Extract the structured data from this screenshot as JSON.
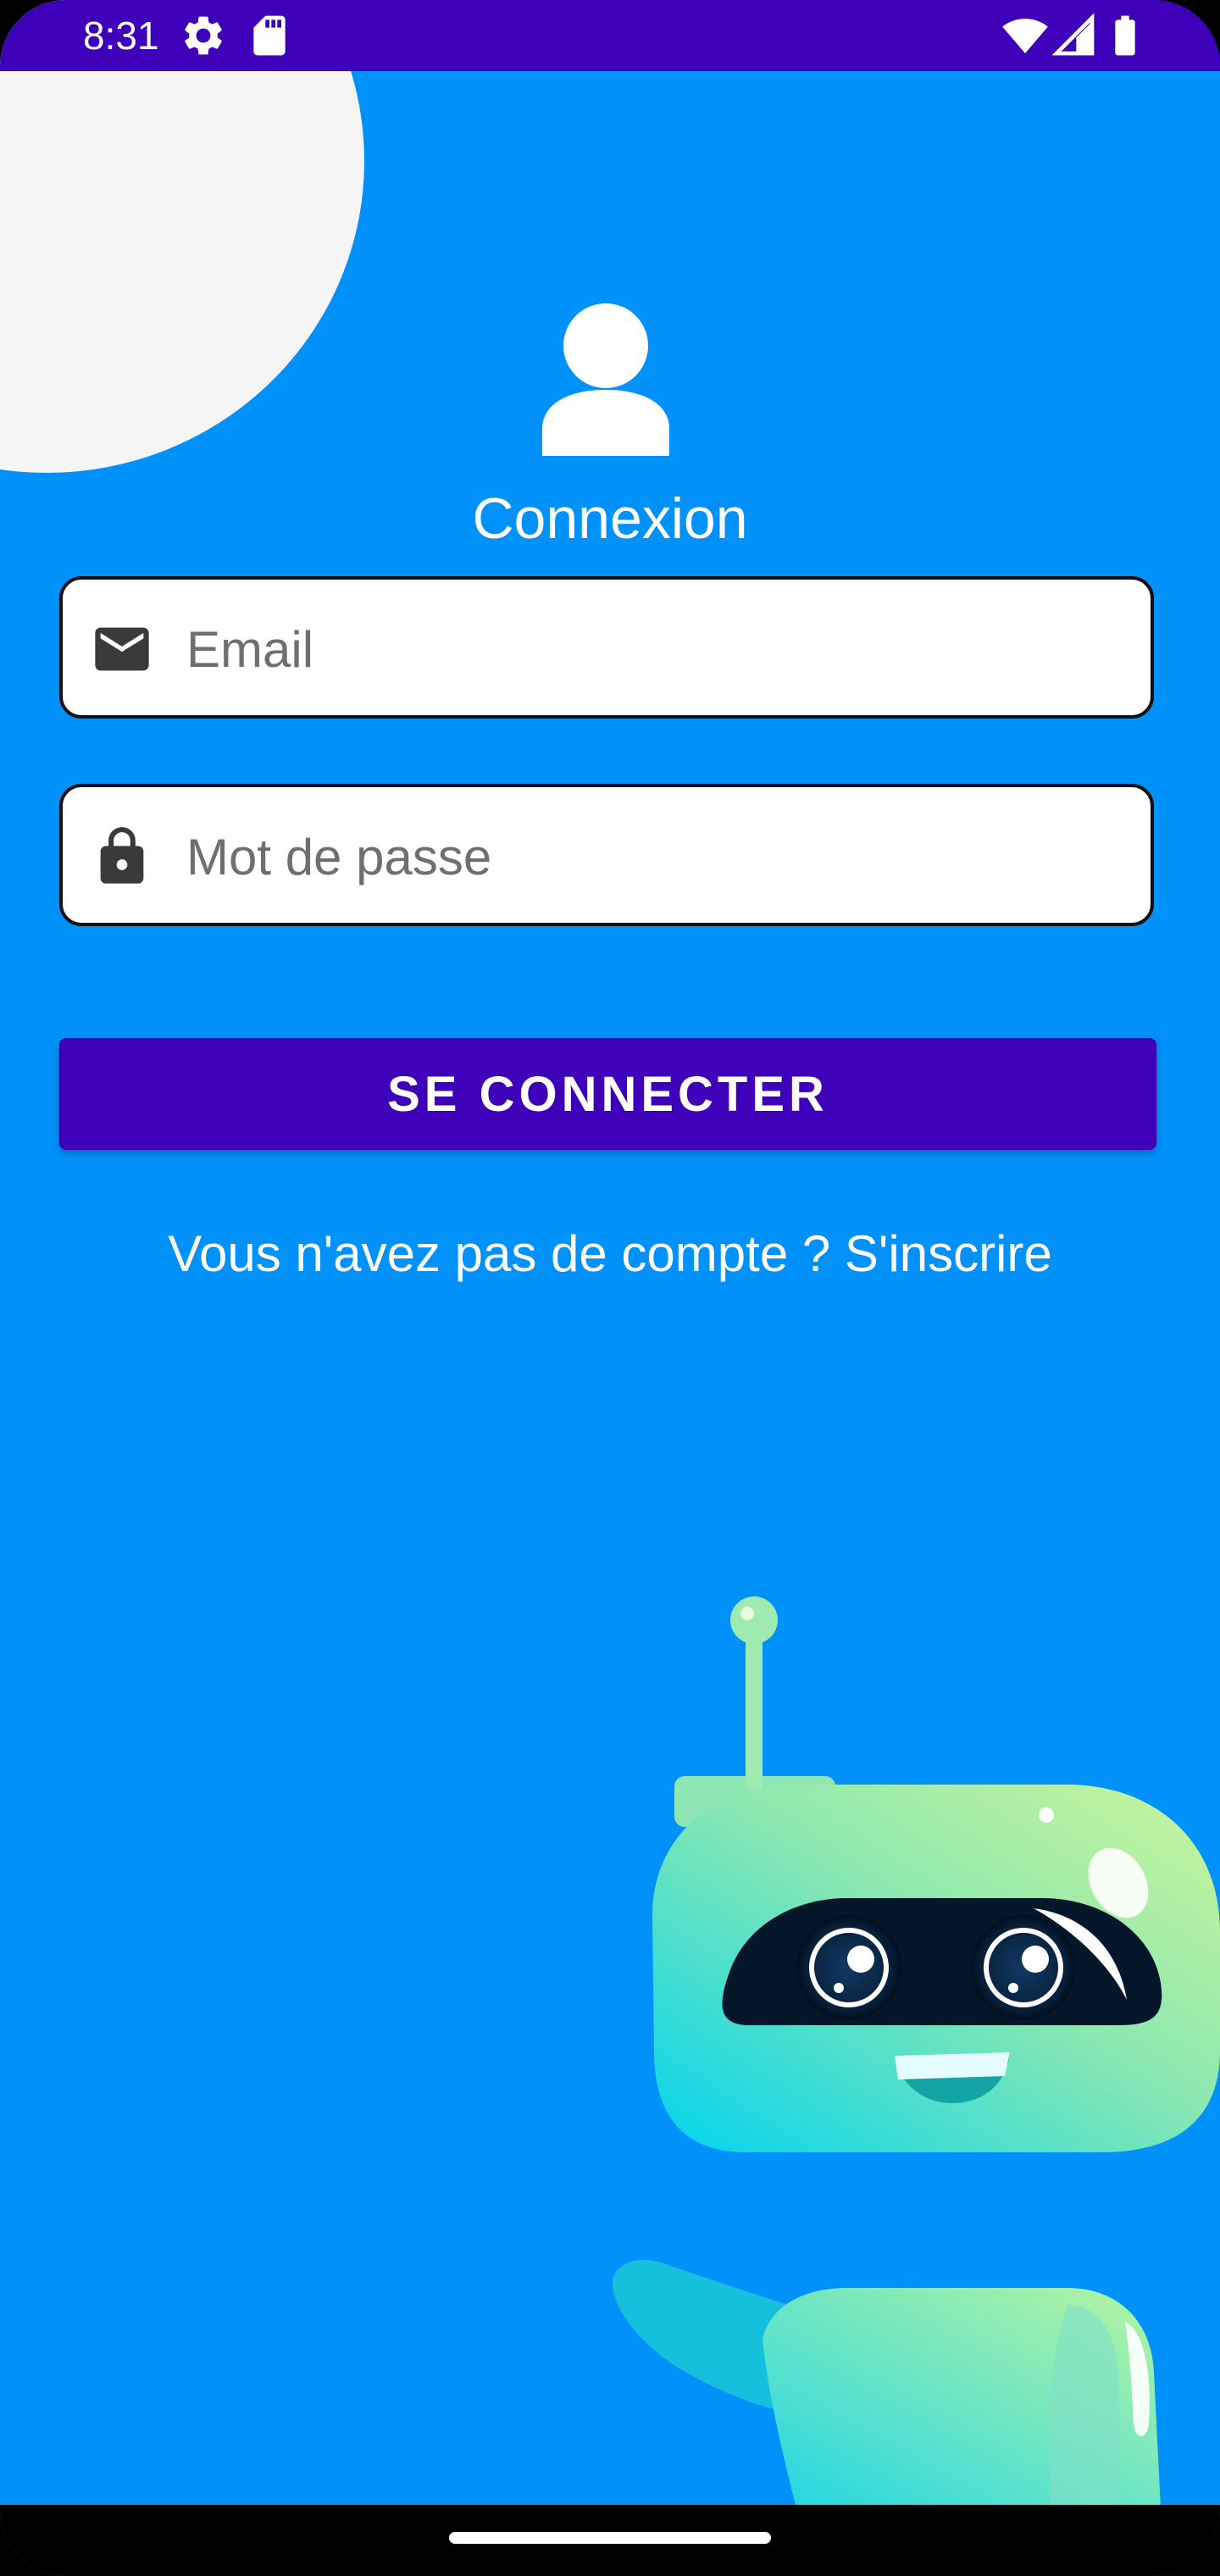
{
  "status_bar": {
    "time": "8:31",
    "icons_left": [
      "settings-icon",
      "sd-card-icon"
    ],
    "icons_right": [
      "wifi-icon",
      "signal-icon",
      "battery-icon"
    ]
  },
  "header": {
    "icon": "user-icon",
    "title": "Connexion"
  },
  "form": {
    "email": {
      "icon": "mail-icon",
      "value": "",
      "placeholder": "Email"
    },
    "password": {
      "icon": "lock-icon",
      "value": "",
      "placeholder": "Mot de passe"
    },
    "submit_label": "SE CONNECTER",
    "signup_text": "Vous n'avez pas de compte ? S'inscrire"
  },
  "illustration": "robot-illustration",
  "colors": {
    "background": "#0091FA",
    "primary": "#3E00B8",
    "accent_circle": "#F5F5F5"
  }
}
